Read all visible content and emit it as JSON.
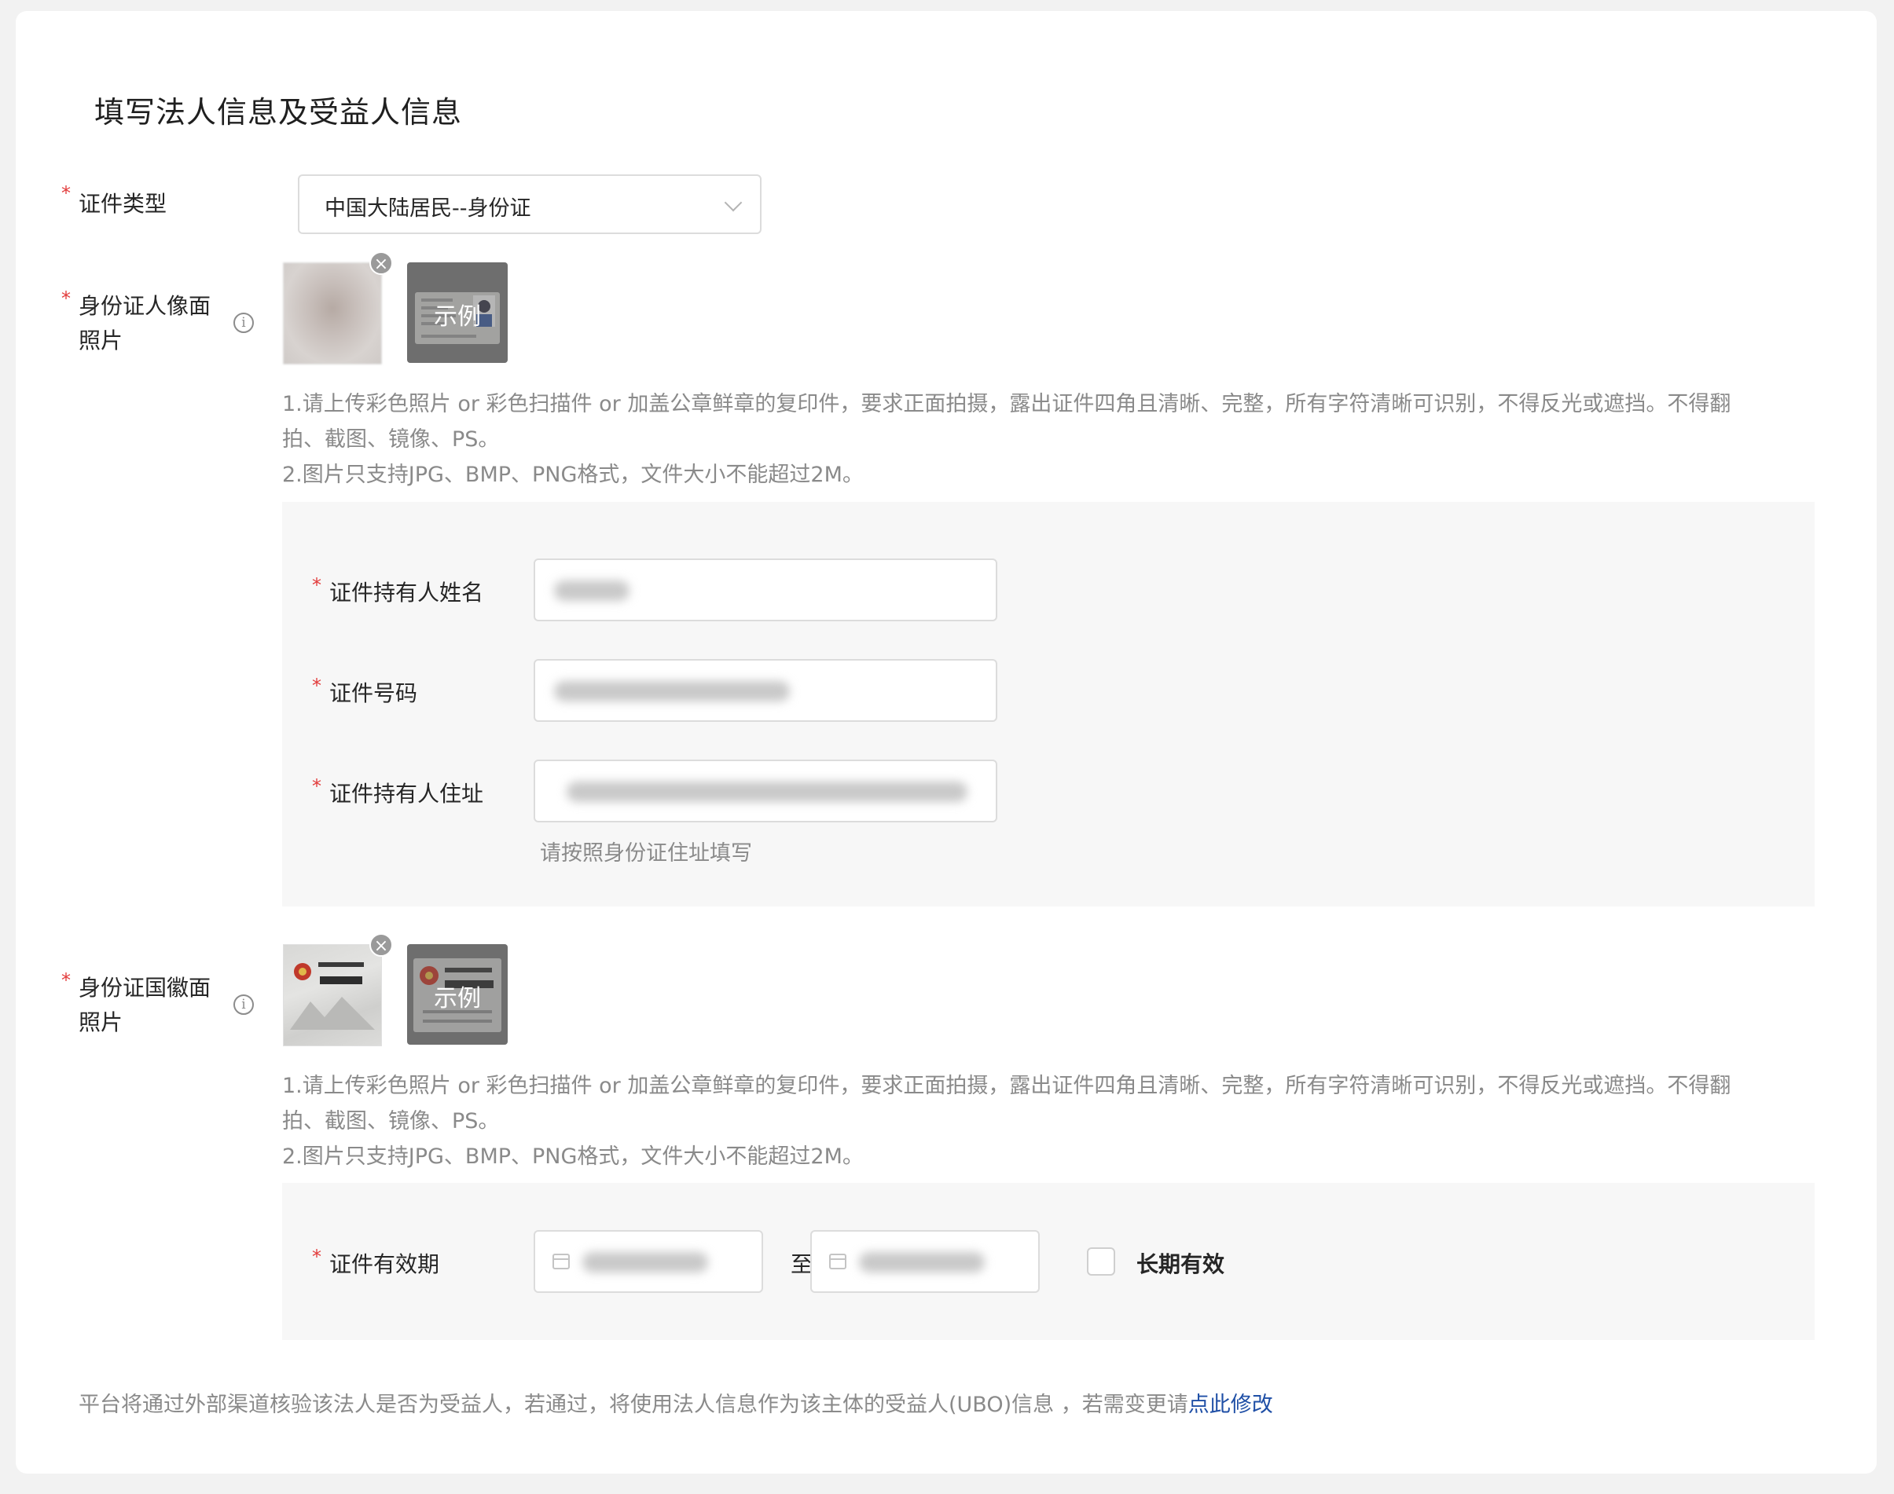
{
  "page_title": "填写法人信息及受益人信息",
  "required_mark": "*",
  "id_type": {
    "label": "证件类型",
    "value": "中国大陆居民--身份证"
  },
  "portrait_photo": {
    "label_line1": "身份证人像面",
    "label_line2": "照片",
    "info_glyph": "i",
    "example_label": "示例",
    "remove_glyph": "×",
    "hint_line1": "1.请上传彩色照片 or 彩色扫描件 or 加盖公章鲜章的复印件，要求正面拍摄，露出证件四角且清晰、完整，所有字符清晰可识别，不得反光或遮挡。不得翻",
    "hint_line2": "拍、截图、镜像、PS。",
    "hint_line3": "2.图片只支持JPG、BMP、PNG格式，文件大小不能超过2M。"
  },
  "holder_panel": {
    "name_label": "证件持有人姓名",
    "number_label": "证件号码",
    "address_label": "证件持有人住址",
    "address_hint": "请按照身份证住址填写"
  },
  "emblem_photo": {
    "label_line1": "身份证国徽面",
    "label_line2": "照片",
    "info_glyph": "i",
    "example_label": "示例",
    "remove_glyph": "×",
    "hint_line1": "1.请上传彩色照片 or 彩色扫描件 or 加盖公章鲜章的复印件，要求正面拍摄，露出证件四角且清晰、完整，所有字符清晰可识别，不得反光或遮挡。不得翻",
    "hint_line2": "拍、截图、镜像、PS。",
    "hint_line3": "2.图片只支持JPG、BMP、PNG格式，文件大小不能超过2M。"
  },
  "validity": {
    "label": "证件有效期",
    "separator": "至",
    "long_term_label": "长期有效",
    "long_term_checked": false
  },
  "footer": {
    "note": "平台将通过外部渠道核验该法人是否为受益人，若通过，将使用法人信息作为该主体的受益人(UBO)信息 ，若需变更请",
    "link": "点此修改"
  },
  "colors": {
    "required": "#e23b3b",
    "link": "#1f4fa6",
    "hint": "#8a8a8a",
    "panel_bg": "#f7f7f7"
  },
  "icons": [
    "chevron-down-icon",
    "info-icon",
    "close-icon",
    "calendar-icon"
  ]
}
